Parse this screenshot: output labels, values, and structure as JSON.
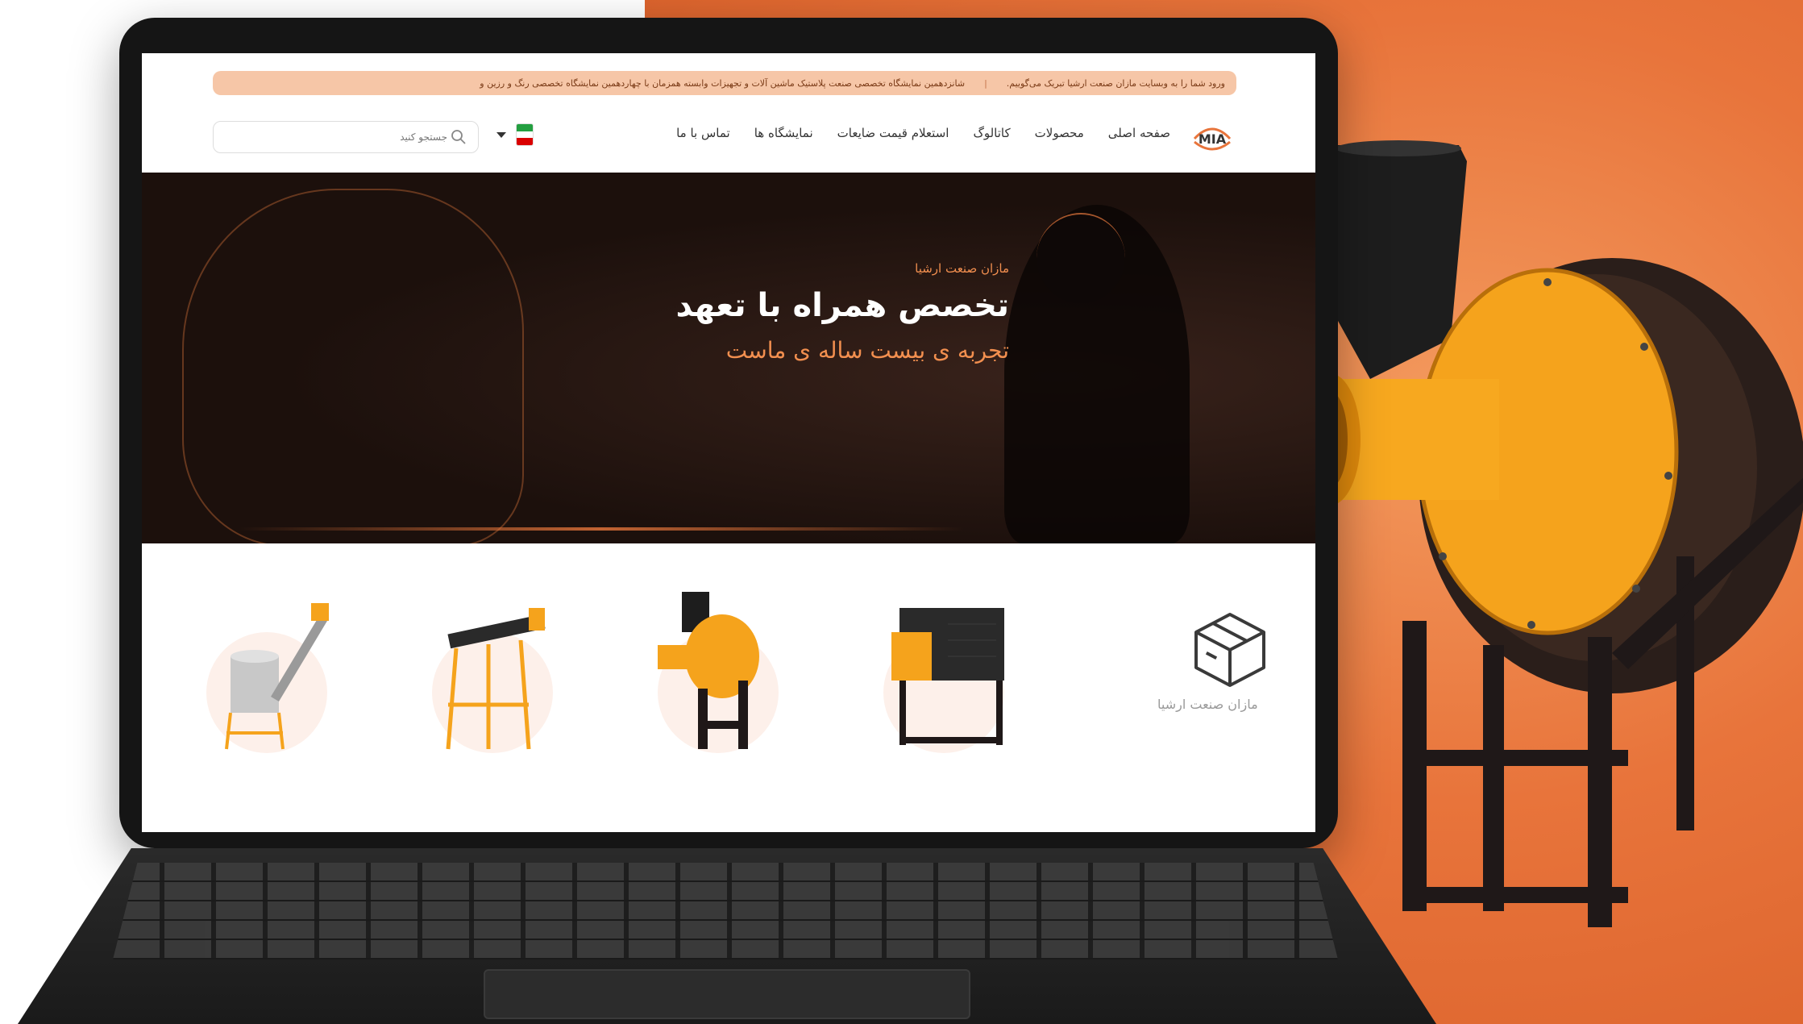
{
  "announcement": {
    "part1": "ورود شما را به وبسایت مازان صنعت ارشیا تبریک می‌گوییم.",
    "part2": "شانزدهمین نمایشگاه تخصصی صنعت پلاستیک ماشین آلات و تجهیزات وابسته همزمان با چهاردهمین نمایشگاه تخصصی رنگ و رزین و"
  },
  "nav": {
    "items": [
      "صفحه اصلی",
      "محصولات",
      "کاتالوگ",
      "استعلام قیمت ضایعات",
      "نمایشگاه ها",
      "تماس با ما"
    ]
  },
  "search": {
    "placeholder": "جستجو کنید"
  },
  "hero": {
    "eyebrow": "مازان صنعت ارشیا",
    "title": "تخصص همراه با تعهد",
    "subtitle": "تجربه ی بیست ساله ی ماست"
  },
  "categories": {
    "label": "مازان صنعت ارشیا",
    "cards": [
      "mixer-machine",
      "stand-frame",
      "blower-fan",
      "box-machine"
    ]
  },
  "colors": {
    "accent": "#f28f4f",
    "orange": "#e8743b",
    "dark": "#1b1210"
  },
  "icons": {
    "logo": "mia-logo",
    "search": "search-icon",
    "box": "box-icon"
  }
}
